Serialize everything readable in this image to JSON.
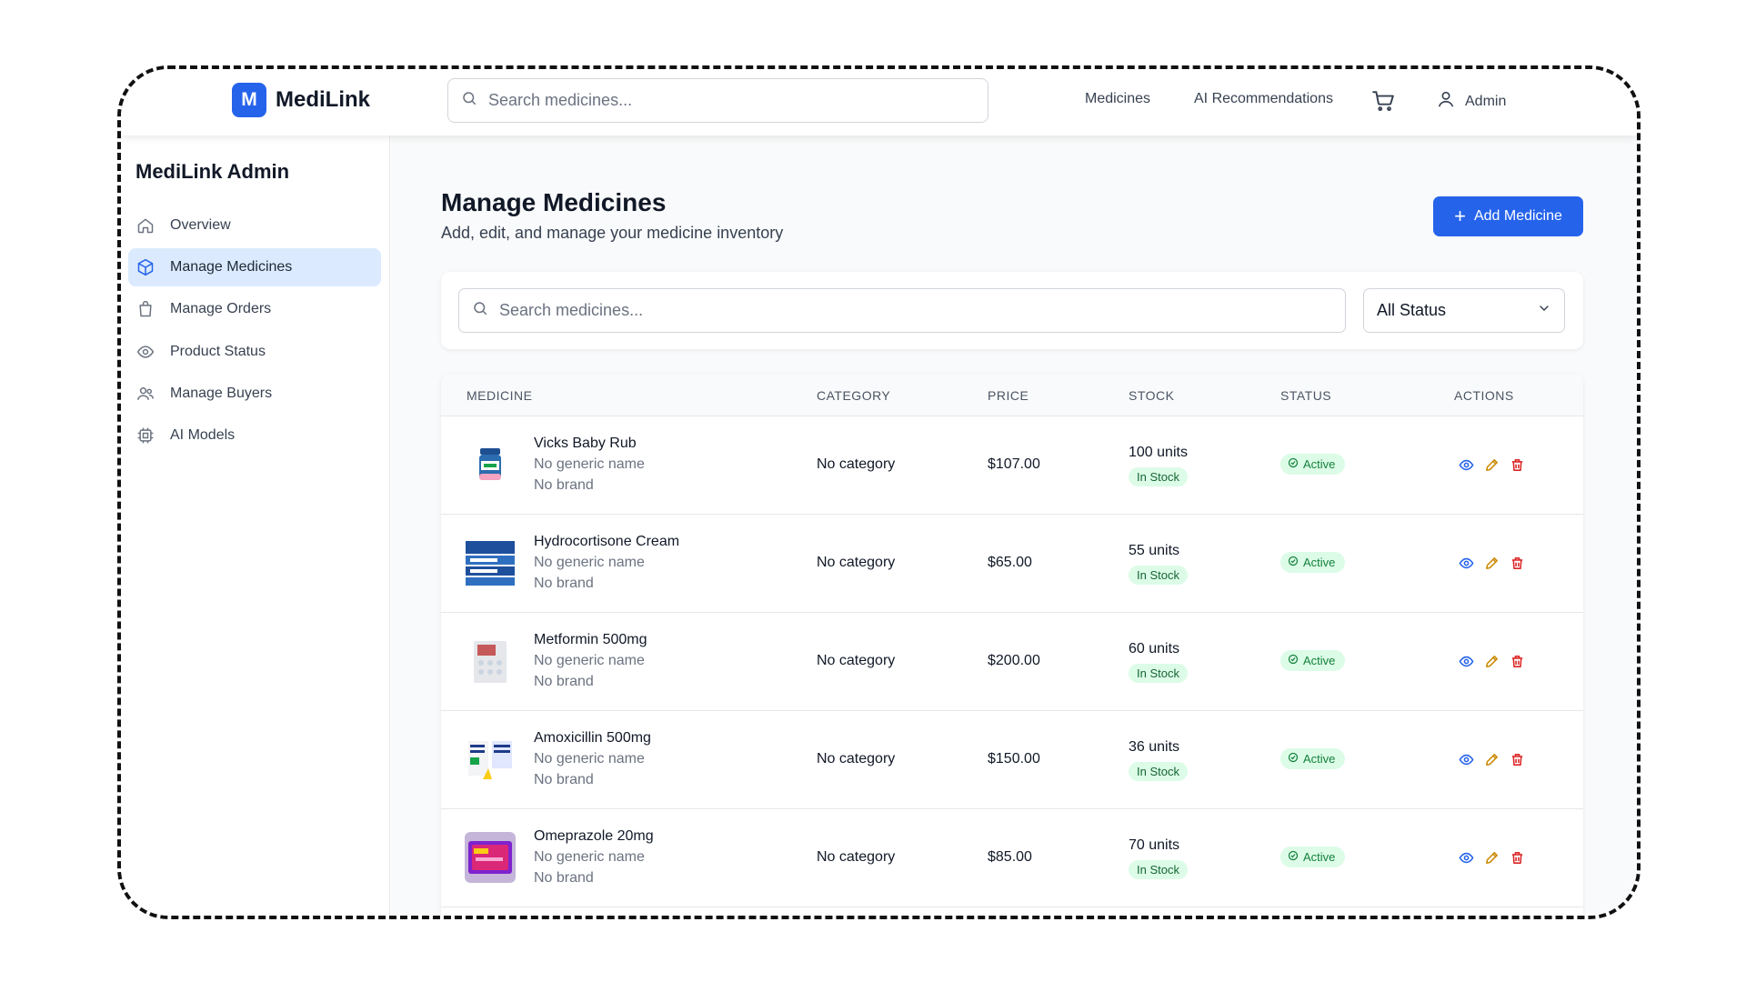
{
  "app": {
    "logo_letter": "M",
    "name": "MediLink"
  },
  "topbar": {
    "search_placeholder": "Search medicines...",
    "nav": [
      "Medicines",
      "AI Recommendations"
    ],
    "user_label": "Admin"
  },
  "sidebar": {
    "title": "MediLink Admin",
    "items": [
      {
        "label": "Overview",
        "icon": "home-icon"
      },
      {
        "label": "Manage Medicines",
        "icon": "box-icon",
        "active": true
      },
      {
        "label": "Manage Orders",
        "icon": "shopping-bag-icon"
      },
      {
        "label": "Product Status",
        "icon": "eye-icon"
      },
      {
        "label": "Manage Buyers",
        "icon": "users-icon"
      },
      {
        "label": "AI Models",
        "icon": "cpu-icon"
      }
    ]
  },
  "main": {
    "title": "Manage Medicines",
    "subtitle": "Add, edit, and manage your medicine inventory",
    "add_button": "Add Medicine",
    "filter": {
      "search_placeholder": "Search medicines...",
      "status_selected": "All Status"
    },
    "table": {
      "headers": [
        "MEDICINE",
        "CATEGORY",
        "PRICE",
        "STOCK",
        "STATUS",
        "ACTIONS"
      ],
      "rows": [
        {
          "name": "Vicks Baby Rub",
          "generic": "No generic name",
          "brand": "No brand",
          "category": "No category",
          "price": "$107.00",
          "units": "100 units",
          "stock": "In Stock",
          "status": "Active"
        },
        {
          "name": "Hydrocortisone Cream",
          "generic": "No generic name",
          "brand": "No brand",
          "category": "No category",
          "price": "$65.00",
          "units": "55 units",
          "stock": "In Stock",
          "status": "Active"
        },
        {
          "name": "Metformin 500mg",
          "generic": "No generic name",
          "brand": "No brand",
          "category": "No category",
          "price": "$200.00",
          "units": "60 units",
          "stock": "In Stock",
          "status": "Active"
        },
        {
          "name": "Amoxicillin 500mg",
          "generic": "No generic name",
          "brand": "No brand",
          "category": "No category",
          "price": "$150.00",
          "units": "36 units",
          "stock": "In Stock",
          "status": "Active"
        },
        {
          "name": "Omeprazole 20mg",
          "generic": "No generic name",
          "brand": "No brand",
          "category": "No category",
          "price": "$85.00",
          "units": "70 units",
          "stock": "In Stock",
          "status": "Active"
        }
      ]
    }
  },
  "colors": {
    "primary": "#2563eb",
    "active_bg": "#dbeafe",
    "success_bg": "#dcfce7",
    "success_text": "#15803d",
    "edit": "#ca8a04",
    "delete": "#dc2626"
  }
}
